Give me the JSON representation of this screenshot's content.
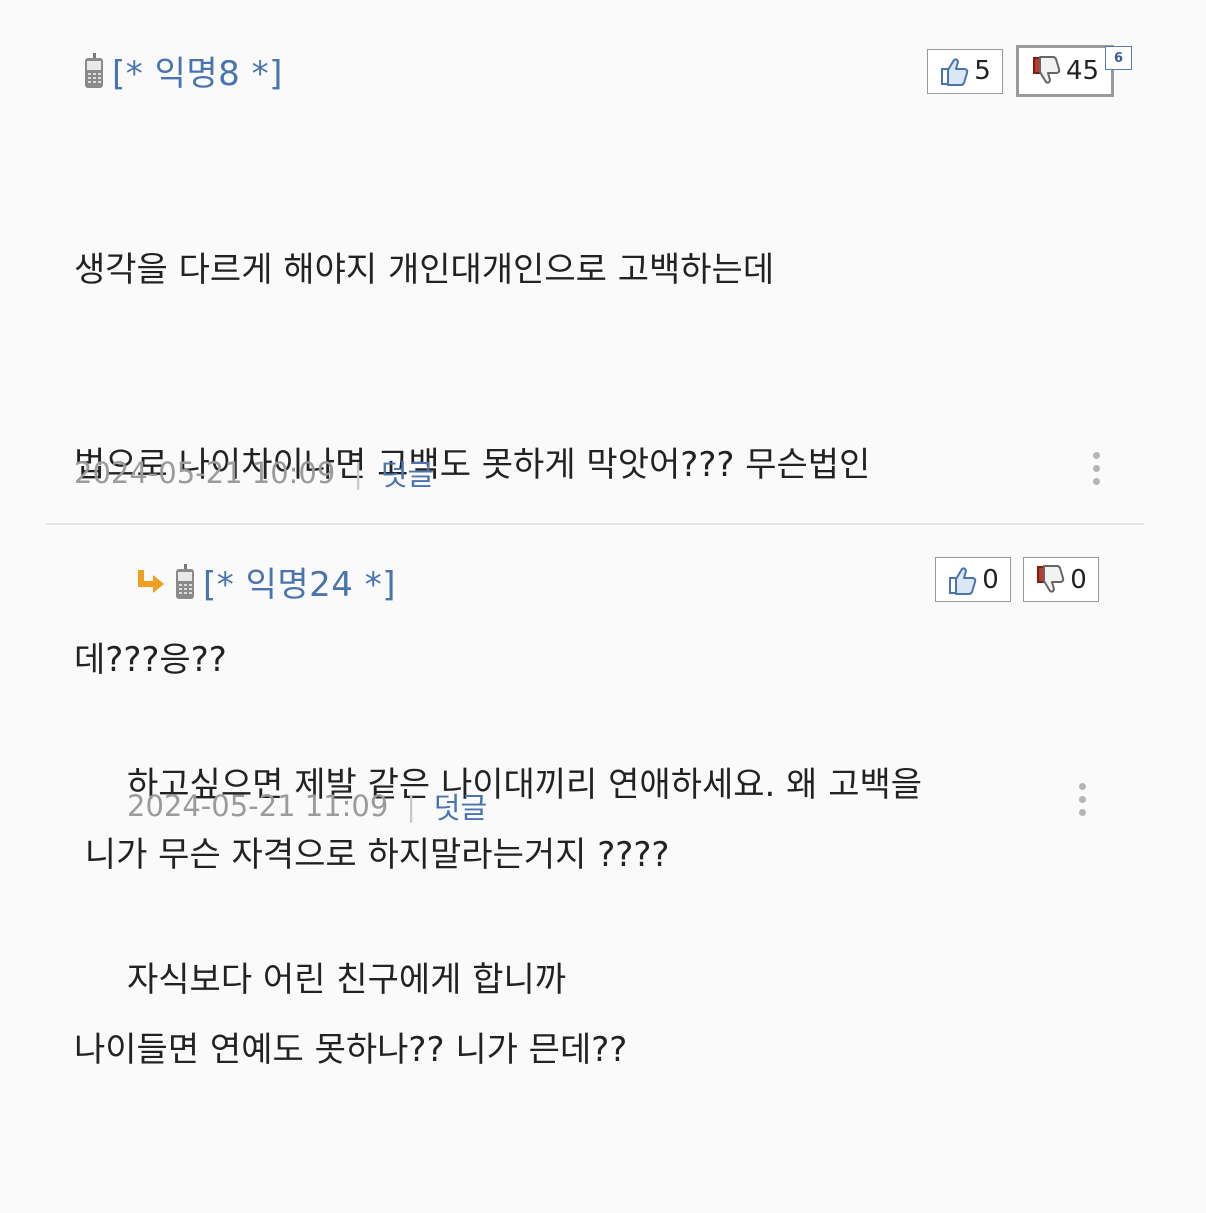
{
  "comments": [
    {
      "author": "[* 익명8 *]",
      "likes": "5",
      "dislikes": "45",
      "dislike_badge": "6",
      "lines": [
        "생각을 다르게 해야지 개인대개인으로 고백하는데",
        "법으로 나이차이나면 고백도 못하게 막앗어??? 무슨법인",
        "데???응??",
        " 니가 무슨 자격으로 하지말라는거지 ????",
        "나이들면 연예도 못하나?? 니가 믄데??"
      ],
      "timestamp": "2024-05-21 10:09",
      "separator": "|",
      "reply_label": "덧글"
    },
    {
      "author": "[* 익명24 *]",
      "likes": "0",
      "dislikes": "0",
      "lines": [
        "하고싶으면 제발 같은 나이대끼리 연애하세요. 왜 고백을",
        "자식보다 어린 친구에게 합니까"
      ],
      "timestamp": "2024-05-21 11:09",
      "separator": "|",
      "reply_label": "덧글"
    }
  ],
  "icons": {
    "phone": "mobile-phone-icon",
    "like": "thumbs-up-icon",
    "dislike": "thumbs-down-icon",
    "reply": "reply-arrow-icon",
    "more": "more-vertical-icon"
  },
  "colors": {
    "author": "#4a74b0",
    "reply_link": "#4a74b0",
    "meta": "#9b9b9b",
    "reply_arrow": "#f0a020",
    "dislike_accent": "#c0392b"
  }
}
